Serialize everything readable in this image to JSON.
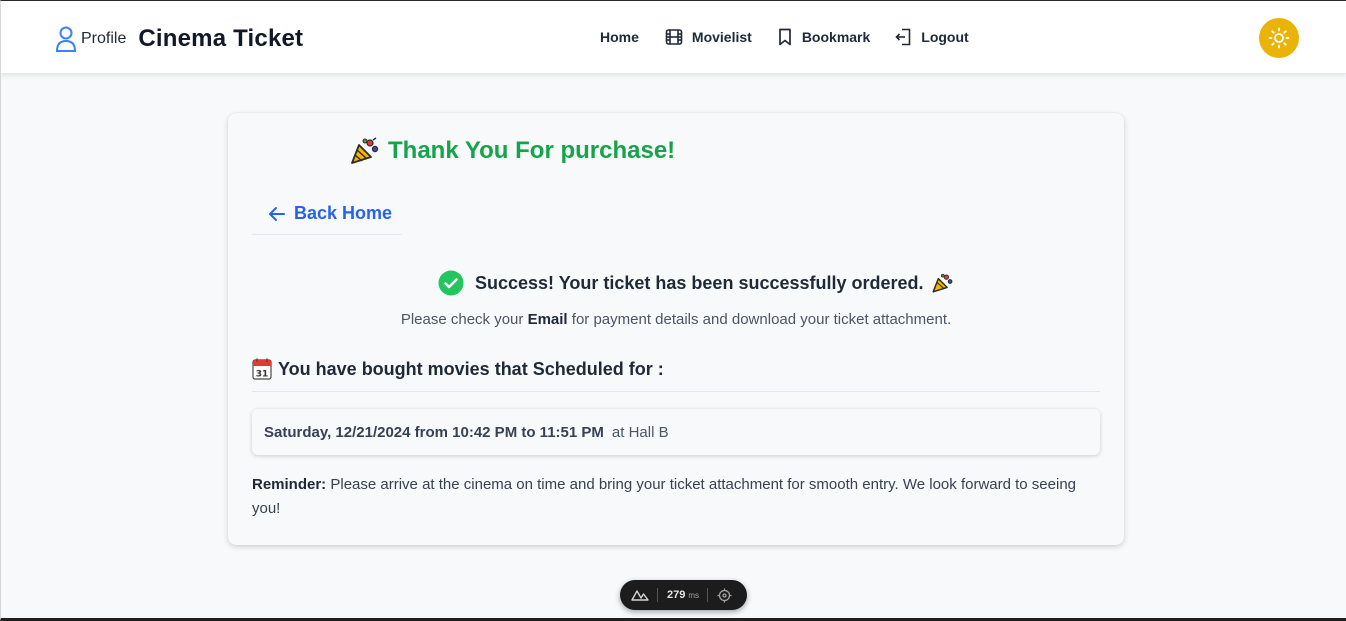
{
  "header": {
    "profile_label": "Profile",
    "site_title": "Cinema Ticket",
    "nav": {
      "home": "Home",
      "movielist": "Movielist",
      "bookmark": "Bookmark",
      "logout": "Logout"
    },
    "theme_toggle_icon": "sun-icon"
  },
  "card": {
    "thank_you": "Thank You For purchase!",
    "back_home": "Back Home",
    "success_message": "Success! Your ticket has been successfully ordered.",
    "check_prefix": "Please check your",
    "check_email": "Email",
    "check_suffix": "for payment details and download your ticket attachment.",
    "schedule_heading": "You have bought movies that Scheduled for :",
    "schedule": {
      "time": "Saturday, 12/21/2024 from 10:42 PM to 11:51 PM",
      "hall": "at Hall B"
    },
    "reminder_label": "Reminder:",
    "reminder_text": "Please arrive at the cinema on time and bring your ticket attachment for smooth entry. We look forward to seeing you!"
  },
  "dev_badge": {
    "ms_value": "279",
    "ms_unit": "ms"
  },
  "colors": {
    "success_green": "#16a34a",
    "link_blue": "#2563eb",
    "toggle_yellow": "#eab308",
    "profile_blue": "#3b82f6"
  }
}
